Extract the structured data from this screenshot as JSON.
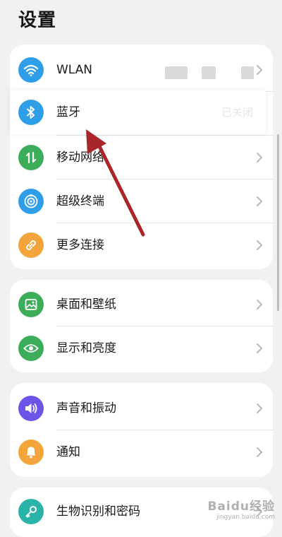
{
  "page": {
    "title": "设置"
  },
  "groups": [
    {
      "items": [
        {
          "label": "WLAN",
          "icon": "wifi-icon",
          "color": "#2f9ee8"
        },
        {
          "label": "蓝牙",
          "icon": "bluetooth-icon",
          "color": "#2f9ee8",
          "status": "已关闭"
        },
        {
          "label": "移动网络",
          "icon": "mobile-data-icon",
          "color": "#3cae5a"
        },
        {
          "label": "超级终端",
          "icon": "super-device-icon",
          "color": "#2f9ee8"
        },
        {
          "label": "更多连接",
          "icon": "link-icon",
          "color": "#f3a43a"
        }
      ]
    },
    {
      "items": [
        {
          "label": "桌面和壁纸",
          "icon": "wallpaper-icon",
          "color": "#3cae5a"
        },
        {
          "label": "显示和亮度",
          "icon": "eye-icon",
          "color": "#3cae5a"
        }
      ]
    },
    {
      "items": [
        {
          "label": "声音和振动",
          "icon": "speaker-icon",
          "color": "#6b55e8"
        },
        {
          "label": "通知",
          "icon": "bell-icon",
          "color": "#f3a43a"
        }
      ]
    },
    {
      "items": [
        {
          "label": "生物识别和密码",
          "icon": "key-icon",
          "color": "#2bb3a8"
        }
      ]
    }
  ],
  "watermark": {
    "main": "Baidu经验",
    "sub": "jingyan.baidu.com"
  },
  "annotation": {
    "arrow_color": "#a8262a"
  }
}
